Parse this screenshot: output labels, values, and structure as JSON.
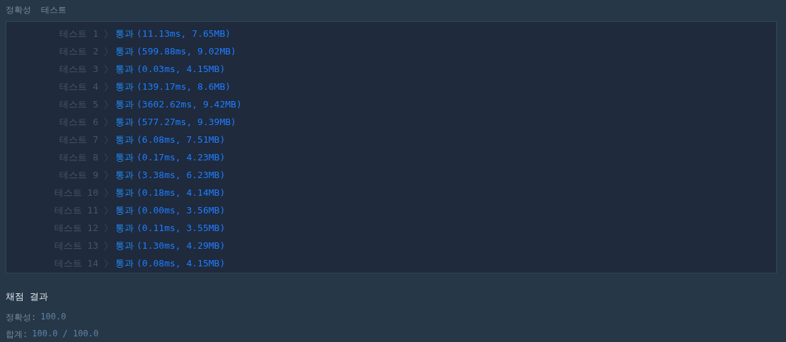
{
  "header_labels": [
    "정확성",
    "테스트"
  ],
  "tests": [
    {
      "label": "테스트 1",
      "status": "통과",
      "detail": "(11.13ms, 7.65MB)"
    },
    {
      "label": "테스트 2",
      "status": "통과",
      "detail": "(599.88ms, 9.02MB)"
    },
    {
      "label": "테스트 3",
      "status": "통과",
      "detail": "(0.03ms, 4.15MB)"
    },
    {
      "label": "테스트 4",
      "status": "통과",
      "detail": "(139.17ms, 8.6MB)"
    },
    {
      "label": "테스트 5",
      "status": "통과",
      "detail": "(3602.62ms, 9.42MB)"
    },
    {
      "label": "테스트 6",
      "status": "통과",
      "detail": "(577.27ms, 9.39MB)"
    },
    {
      "label": "테스트 7",
      "status": "통과",
      "detail": "(6.08ms, 7.51MB)"
    },
    {
      "label": "테스트 8",
      "status": "통과",
      "detail": "(0.17ms, 4.23MB)"
    },
    {
      "label": "테스트 9",
      "status": "통과",
      "detail": "(3.38ms, 6.23MB)"
    },
    {
      "label": "테스트 10",
      "status": "통과",
      "detail": "(0.18ms, 4.14MB)"
    },
    {
      "label": "테스트 11",
      "status": "통과",
      "detail": "(0.00ms, 3.56MB)"
    },
    {
      "label": "테스트 12",
      "status": "통과",
      "detail": "(0.11ms, 3.55MB)"
    },
    {
      "label": "테스트 13",
      "status": "통과",
      "detail": "(1.30ms, 4.29MB)"
    },
    {
      "label": "테스트 14",
      "status": "통과",
      "detail": "(0.08ms, 4.15MB)"
    }
  ],
  "result": {
    "title": "채점 결과",
    "lines": [
      {
        "label": "정확성:",
        "value": "100.0"
      },
      {
        "label": "합계:",
        "value": "100.0 / 100.0"
      }
    ]
  }
}
